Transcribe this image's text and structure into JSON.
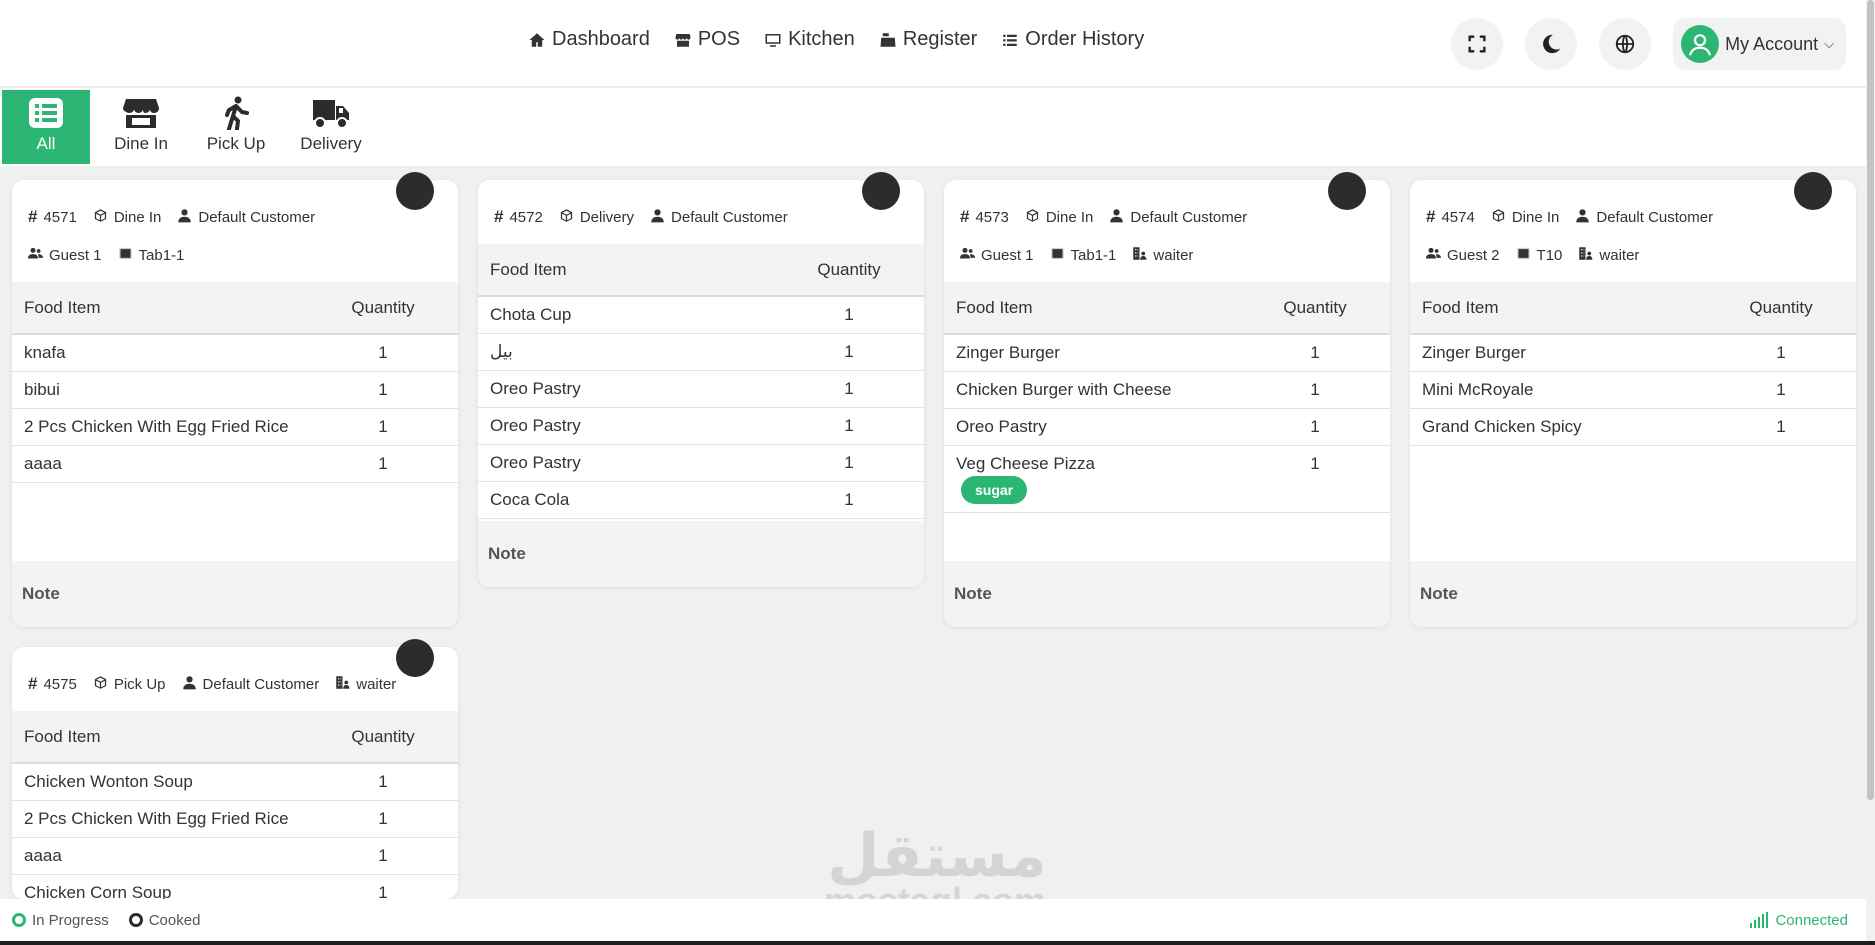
{
  "nav": {
    "items": [
      {
        "label": "Dashboard",
        "icon": "home-icon"
      },
      {
        "label": "POS",
        "icon": "store-icon"
      },
      {
        "label": "Kitchen",
        "icon": "monitor-icon"
      },
      {
        "label": "Register",
        "icon": "cash-register-icon"
      },
      {
        "label": "Order History",
        "icon": "list-icon"
      }
    ],
    "account_label": "My Account"
  },
  "filters": {
    "tabs": [
      {
        "label": "All",
        "icon": "list-icon",
        "active": true
      },
      {
        "label": "Dine In",
        "icon": "store-icon"
      },
      {
        "label": "Pick Up",
        "icon": "walking-icon"
      },
      {
        "label": "Delivery",
        "icon": "truck-icon"
      }
    ]
  },
  "table_headers": {
    "item": "Food Item",
    "qty": "Quantity"
  },
  "note_label": "Note",
  "orders": [
    {
      "id": "4571",
      "type": "Dine In",
      "customer": "Default Customer",
      "guests": "Guest 1",
      "table": "Tab1-1",
      "items": [
        {
          "name": "knafa",
          "qty": "1"
        },
        {
          "name": "bibui",
          "qty": "1"
        },
        {
          "name": "2 Pcs Chicken With Egg Fried Rice",
          "qty": "1"
        },
        {
          "name": "aaaa",
          "qty": "1"
        }
      ]
    },
    {
      "id": "4572",
      "type": "Delivery",
      "customer": "Default Customer",
      "items": [
        {
          "name": "Chota Cup",
          "qty": "1"
        },
        {
          "name": "بيل",
          "qty": "1"
        },
        {
          "name": "Oreo Pastry",
          "qty": "1"
        },
        {
          "name": "Oreo Pastry",
          "qty": "1"
        },
        {
          "name": "Oreo Pastry",
          "qty": "1"
        },
        {
          "name": "Coca Cola",
          "qty": "1"
        }
      ]
    },
    {
      "id": "4573",
      "type": "Dine In",
      "customer": "Default Customer",
      "guests": "Guest 1",
      "table": "Tab1-1",
      "waiter": "waiter",
      "items": [
        {
          "name": "Zinger Burger",
          "qty": "1"
        },
        {
          "name": "Chicken Burger with Cheese",
          "qty": "1"
        },
        {
          "name": "Oreo Pastry",
          "qty": "1"
        },
        {
          "name": "Veg Cheese Pizza",
          "qty": "1",
          "tag": "sugar"
        }
      ]
    },
    {
      "id": "4574",
      "type": "Dine In",
      "customer": "Default Customer",
      "guests": "Guest 2",
      "table": "T10",
      "waiter": "waiter",
      "items": [
        {
          "name": "Zinger Burger",
          "qty": "1"
        },
        {
          "name": "Mini McRoyale",
          "qty": "1"
        },
        {
          "name": "Grand Chicken Spicy",
          "qty": "1"
        }
      ]
    },
    {
      "id": "4575",
      "type": "Pick Up",
      "customer": "Default Customer",
      "waiter": "waiter",
      "items": [
        {
          "name": "Chicken Wonton Soup",
          "qty": "1"
        },
        {
          "name": "2 Pcs Chicken With Egg Fried Rice",
          "qty": "1"
        },
        {
          "name": "aaaa",
          "qty": "1"
        },
        {
          "name": "Chicken Corn Soup",
          "qty": "1"
        }
      ]
    }
  ],
  "status": {
    "in_progress": "In Progress",
    "cooked": "Cooked",
    "connection": "Connected"
  },
  "watermark": {
    "text": "mostaql.com",
    "logo": "مستقل"
  },
  "colors": {
    "accent": "#2bb673",
    "dark": "#2c2c2c"
  }
}
